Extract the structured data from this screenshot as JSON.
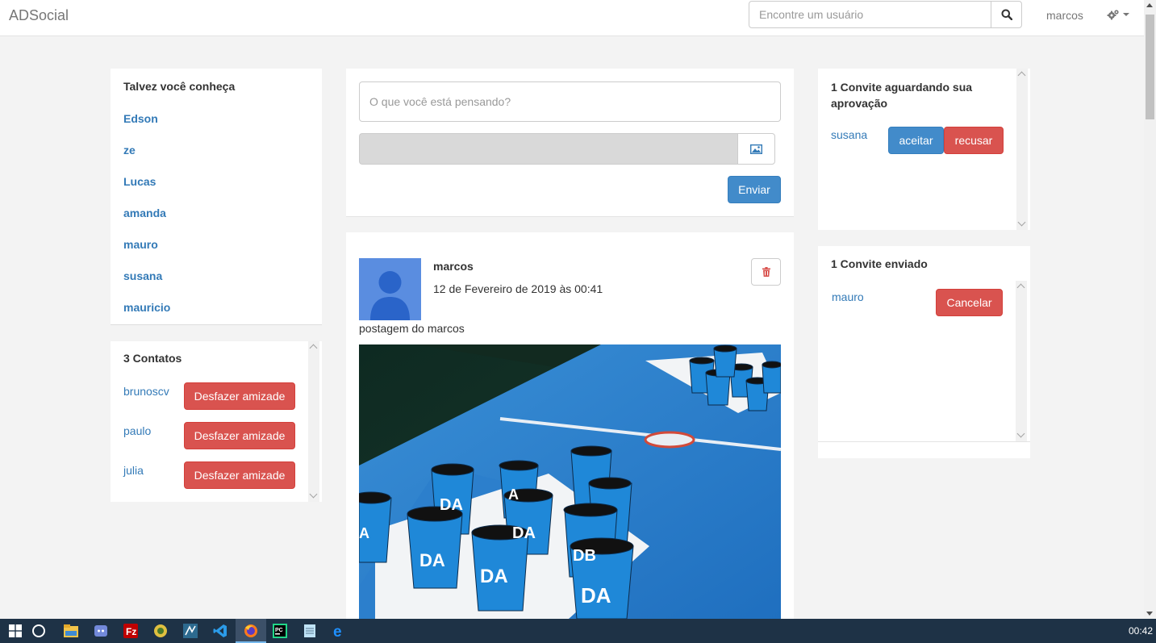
{
  "navbar": {
    "brand": "ADSocial",
    "search_placeholder": "Encontre um usuário",
    "user": "marcos"
  },
  "suggestions": {
    "title": "Talvez você conheça",
    "items": [
      "Edson",
      "ze",
      "Lucas",
      "amanda",
      "mauro",
      "susana",
      "mauricio"
    ]
  },
  "contacts": {
    "title": "3 Contatos",
    "button_label": "Desfazer amizade",
    "items": [
      "brunoscv",
      "paulo",
      "julia"
    ]
  },
  "composer": {
    "placeholder": "O que você está pensando?",
    "submit_label": "Enviar"
  },
  "post": {
    "author": "marcos",
    "date": "12 de Fevereiro de 2019 às 00:41",
    "text": "postagem do marcos"
  },
  "invites_pending": {
    "title": "1 Convite aguardando sua aprovação",
    "user": "susana",
    "accept_label": "aceitar",
    "reject_label": "recusar"
  },
  "invites_sent": {
    "title": "1 Convite enviado",
    "user": "mauro",
    "cancel_label": "Cancelar"
  },
  "taskbar": {
    "icons": [
      "windows-start-icon",
      "cortana-icon",
      "file-explorer-icon",
      "discord-icon",
      "filezilla-icon",
      "heidisql-icon",
      "mysql-workbench-icon",
      "vscode-icon",
      "firefox-icon",
      "pycharm-icon",
      "notepad-icon",
      "edge-icon"
    ],
    "clock": "00:42"
  },
  "colors": {
    "primary": "#428bca",
    "danger": "#d9534f",
    "link": "#337ab7",
    "background": "#f3f3f3"
  }
}
